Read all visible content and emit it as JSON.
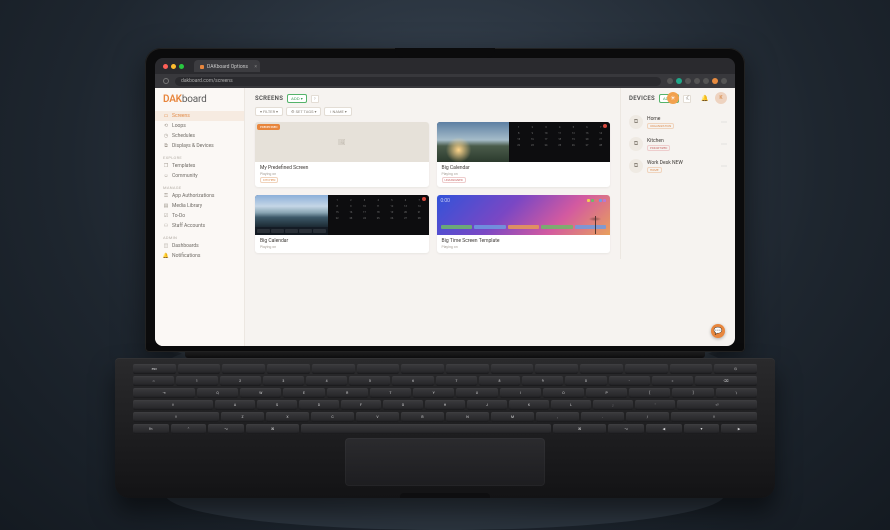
{
  "browser": {
    "tab_title": "DAKboard Options",
    "url": "dakboard.com/screens"
  },
  "brand": {
    "accent": "DAK",
    "rest": "board"
  },
  "header": {
    "avatar_initial": "K"
  },
  "sidebar": {
    "groups": [
      {
        "items": [
          {
            "label": "Screens",
            "icon": "monitor",
            "active": true
          },
          {
            "label": "Loops",
            "icon": "loop"
          },
          {
            "label": "Schedules",
            "icon": "clock"
          },
          {
            "label": "Displays & Devices",
            "icon": "device"
          }
        ]
      },
      {
        "label": "EXPLORE",
        "items": [
          {
            "label": "Templates",
            "icon": "templates"
          },
          {
            "label": "Community",
            "icon": "community"
          }
        ]
      },
      {
        "label": "MANAGE",
        "items": [
          {
            "label": "App Authorizations",
            "icon": "auth"
          },
          {
            "label": "Media Library",
            "icon": "media"
          },
          {
            "label": "To-Do",
            "icon": "todo"
          },
          {
            "label": "Staff Accounts",
            "icon": "staff"
          }
        ]
      },
      {
        "label": "ADMIN",
        "items": [
          {
            "label": "Dashboards",
            "icon": "dash"
          },
          {
            "label": "Notifications",
            "icon": "bell"
          }
        ]
      }
    ]
  },
  "screens": {
    "heading": "SCREENS",
    "add_label": "ADD ▾",
    "filters": {
      "filter": "▾ FILTER ▾",
      "tags": "⚙ SET TAGS ▾",
      "name": "↕ NAME ▾"
    },
    "cards": [
      {
        "title": "My Predefined Screen",
        "sub": "Playing on",
        "tag": "KITCHEN",
        "tag_style": "orange",
        "badge": "PREDEFINED",
        "thumb": "empty"
      },
      {
        "title": "Big Calendar",
        "sub": "Playing on",
        "tag": "UNASSIGNED",
        "tag_style": "red",
        "thumb": "cal-a"
      },
      {
        "title": "Big Calendar",
        "sub": "Playing on",
        "thumb": "cal-b"
      },
      {
        "title": "Big Time Screen Template",
        "sub": "Playing on",
        "thumb": "gradient",
        "clock": "0:00"
      }
    ]
  },
  "devices": {
    "heading": "DEVICES",
    "add_label": "ADD ▾",
    "items": [
      {
        "name": "Home",
        "tag": "ORGANIZATION",
        "tag_style": "orange"
      },
      {
        "name": "Kitchen",
        "tag": "PRIORITIZED",
        "tag_style": "red"
      },
      {
        "name": "Work Desk NEW",
        "tag": "HOME",
        "tag_style": "orange"
      }
    ]
  },
  "colors": {
    "accent": "#e8863d",
    "green": "#54b36a"
  }
}
